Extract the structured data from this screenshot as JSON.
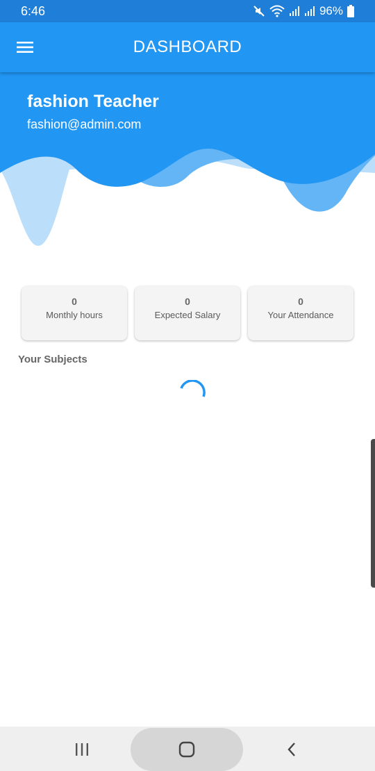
{
  "status_bar": {
    "time": "6:46",
    "battery": "96%",
    "icons": [
      "mute-icon",
      "wifi-icon",
      "signal-icon",
      "signal-icon",
      "battery-icon"
    ]
  },
  "app_bar": {
    "title": "DASHBOARD",
    "menu_icon": "hamburger-menu-icon",
    "color": "#2196f3"
  },
  "profile": {
    "name": "fashion Teacher",
    "email": "fashion@admin.com"
  },
  "stats": [
    {
      "value": "0",
      "label": "Monthly hours"
    },
    {
      "value": "0",
      "label": "Expected Salary"
    },
    {
      "value": "0",
      "label": "Your Attendance"
    }
  ],
  "subjects": {
    "title": "Your Subjects",
    "loading": true
  },
  "nav_bar": {
    "icons": [
      "recent-apps-icon",
      "home-icon",
      "back-icon"
    ]
  },
  "colors": {
    "status_bar": "#1f7fd8",
    "primary": "#2196f3",
    "wave_light": "#bbdefb",
    "wave_mid": "#64b5f6"
  }
}
